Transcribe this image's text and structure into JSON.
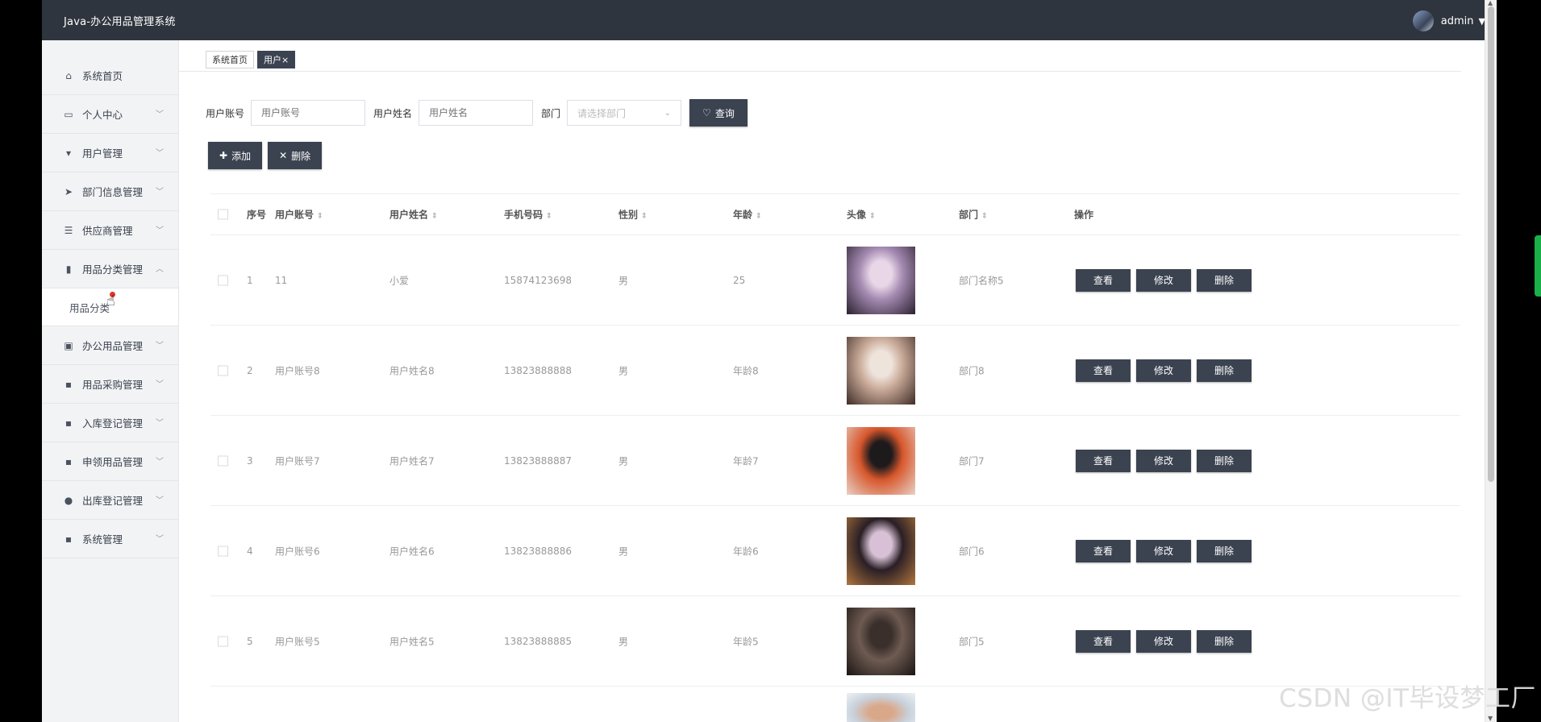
{
  "app": {
    "title": "Java-办公用品管理系统",
    "user": "admin"
  },
  "sidebar": {
    "items": [
      {
        "label": "系统首页",
        "icon": "home-icon",
        "glyph": "⌂",
        "chevron": false
      },
      {
        "label": "个人中心",
        "icon": "calendar-icon",
        "glyph": "▭",
        "chevron": true
      },
      {
        "label": "用户管理",
        "icon": "brush-icon",
        "glyph": "▾",
        "chevron": true
      },
      {
        "label": "部门信息管理",
        "icon": "send-icon",
        "glyph": "➤",
        "chevron": true
      },
      {
        "label": "供应商管理",
        "icon": "sliders-icon",
        "glyph": "☰",
        "chevron": true
      },
      {
        "label": "用品分类管理",
        "icon": "bar-chart-icon",
        "glyph": "▮",
        "chevron": true,
        "expanded": true,
        "children": [
          "用品分类"
        ]
      },
      {
        "label": "办公用品管理",
        "icon": "clipboard-icon",
        "glyph": "▣",
        "chevron": true
      },
      {
        "label": "用品采购管理",
        "icon": "grid-icon",
        "glyph": "▪",
        "chevron": true
      },
      {
        "label": "入库登记管理",
        "icon": "grid-icon",
        "glyph": "▪",
        "chevron": true
      },
      {
        "label": "申领用品管理",
        "icon": "grid-icon",
        "glyph": "▪",
        "chevron": true
      },
      {
        "label": "出库登记管理",
        "icon": "location-icon",
        "glyph": "●",
        "chevron": true
      },
      {
        "label": "系统管理",
        "icon": "grid-icon",
        "glyph": "▪",
        "chevron": true
      }
    ]
  },
  "tabs": [
    {
      "label": "系统首页",
      "active": false
    },
    {
      "label": "用户×",
      "active": true
    }
  ],
  "filter": {
    "account_label": "用户账号",
    "account_placeholder": "用户账号",
    "name_label": "用户姓名",
    "name_placeholder": "用户姓名",
    "dept_label": "部门",
    "dept_placeholder": "请选择部门",
    "query_button": "查询"
  },
  "actions": {
    "add": "添加",
    "delete": "删除"
  },
  "table": {
    "headers": [
      "序号",
      "用户账号",
      "用户姓名",
      "手机号码",
      "性别",
      "年龄",
      "头像",
      "部门",
      "操作"
    ],
    "rows": [
      {
        "no": "1",
        "account": "11",
        "name": "小爱",
        "phone": "15874123698",
        "gender": "男",
        "age": "25",
        "dept": "部门名称5",
        "avatar_colors": [
          "#e9d7e8",
          "#a58bb2",
          "#2b2030"
        ]
      },
      {
        "no": "2",
        "account": "用户账号8",
        "name": "用户姓名8",
        "phone": "13823888888",
        "gender": "男",
        "age": "年龄8",
        "dept": "部门8",
        "avatar_colors": [
          "#efe4dc",
          "#c9aa98",
          "#3e2c26"
        ]
      },
      {
        "no": "3",
        "account": "用户账号7",
        "name": "用户姓名7",
        "phone": "13823888887",
        "gender": "男",
        "age": "年龄7",
        "dept": "部门7",
        "avatar_colors": [
          "#1d1a1c",
          "#d7572c",
          "#e9d1c6"
        ]
      },
      {
        "no": "4",
        "account": "用户账号6",
        "name": "用户姓名6",
        "phone": "13823888886",
        "gender": "男",
        "age": "年龄6",
        "dept": "部门6",
        "avatar_colors": [
          "#d8c1d6",
          "#2a1f25",
          "#b0763e"
        ]
      },
      {
        "no": "5",
        "account": "用户账号5",
        "name": "用户姓名5",
        "phone": "13823888885",
        "gender": "男",
        "age": "年龄5",
        "dept": "部门5",
        "avatar_colors": [
          "#3a2f2b",
          "#6e5b52",
          "#1b1513"
        ]
      }
    ],
    "row_actions": {
      "view": "查看",
      "edit": "修改",
      "delete": "删除"
    }
  },
  "watermark": "CSDN @IT毕设梦工厂"
}
